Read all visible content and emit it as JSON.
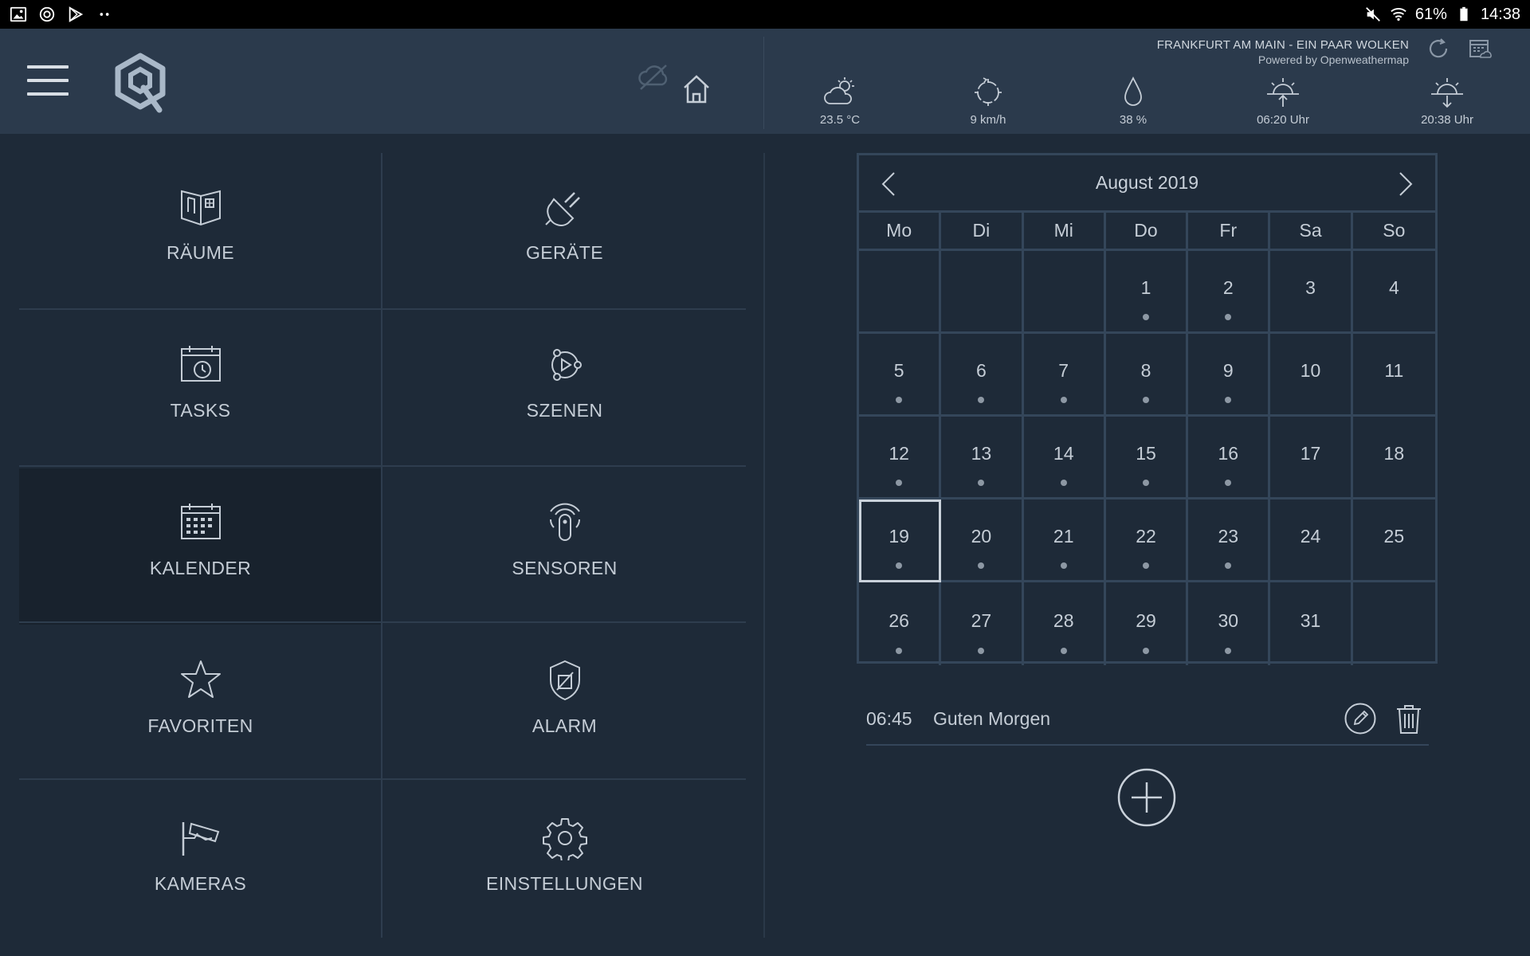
{
  "status_bar": {
    "battery": "61%",
    "time": "14:38"
  },
  "weather": {
    "location": "FRANKFURT AM MAIN - EIN PAAR WOLKEN",
    "powered_by": "Powered by Openweathermap",
    "temperature": "23.5 °C",
    "wind": "9 km/h",
    "humidity": "38 %",
    "sunrise": "06:20 Uhr",
    "sunset": "20:38 Uhr"
  },
  "tiles": {
    "raeume": "RÄUME",
    "geraete": "GERÄTE",
    "tasks": "TASKS",
    "szenen": "SZENEN",
    "kalender": "KALENDER",
    "sensoren": "SENSOREN",
    "favoriten": "FAVORITEN",
    "alarm": "ALARM",
    "kameras": "KAMERAS",
    "einstellungen": "EINSTELLUNGEN"
  },
  "calendar": {
    "title": "August 2019",
    "weekdays": [
      "Mo",
      "Di",
      "Mi",
      "Do",
      "Fr",
      "Sa",
      "So"
    ],
    "days": [
      {
        "num": "",
        "dot": false
      },
      {
        "num": "",
        "dot": false
      },
      {
        "num": "",
        "dot": false
      },
      {
        "num": "1",
        "dot": true
      },
      {
        "num": "2",
        "dot": true
      },
      {
        "num": "3",
        "dot": false
      },
      {
        "num": "4",
        "dot": false
      },
      {
        "num": "5",
        "dot": true
      },
      {
        "num": "6",
        "dot": true
      },
      {
        "num": "7",
        "dot": true
      },
      {
        "num": "8",
        "dot": true
      },
      {
        "num": "9",
        "dot": true
      },
      {
        "num": "10",
        "dot": false
      },
      {
        "num": "11",
        "dot": false
      },
      {
        "num": "12",
        "dot": true
      },
      {
        "num": "13",
        "dot": true
      },
      {
        "num": "14",
        "dot": true
      },
      {
        "num": "15",
        "dot": true
      },
      {
        "num": "16",
        "dot": true
      },
      {
        "num": "17",
        "dot": false
      },
      {
        "num": "18",
        "dot": false
      },
      {
        "num": "19",
        "dot": true,
        "today": true
      },
      {
        "num": "20",
        "dot": true
      },
      {
        "num": "21",
        "dot": true
      },
      {
        "num": "22",
        "dot": true
      },
      {
        "num": "23",
        "dot": true
      },
      {
        "num": "24",
        "dot": false
      },
      {
        "num": "25",
        "dot": false
      },
      {
        "num": "26",
        "dot": true
      },
      {
        "num": "27",
        "dot": true
      },
      {
        "num": "28",
        "dot": true
      },
      {
        "num": "29",
        "dot": true
      },
      {
        "num": "30",
        "dot": true
      },
      {
        "num": "31",
        "dot": false
      },
      {
        "num": "",
        "dot": false
      }
    ]
  },
  "events": [
    {
      "time": "06:45",
      "title": "Guten Morgen"
    }
  ]
}
